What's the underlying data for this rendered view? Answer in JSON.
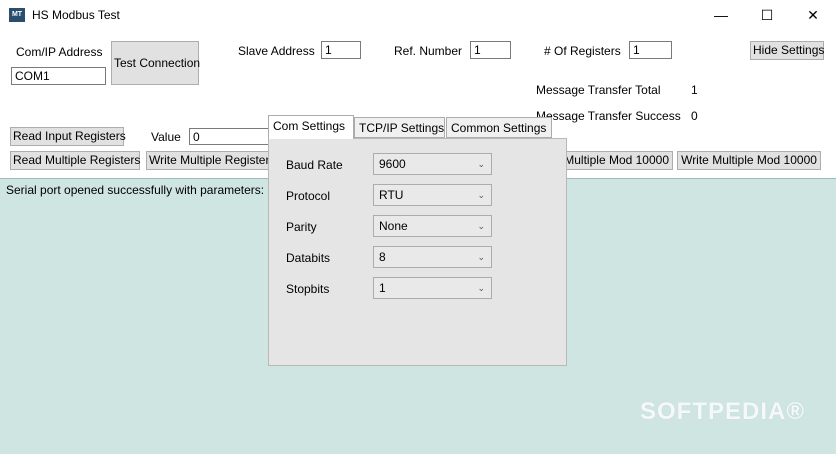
{
  "window": {
    "app_icon_text": "MT",
    "title": "HS Modbus Test",
    "minimize": "—",
    "maximize": "☐",
    "close": "✕"
  },
  "connection": {
    "com_ip_label": "Com/IP Address",
    "com_ip_value": "COM1",
    "test_button": "Test Connection",
    "slave_label": "Slave Address",
    "slave_value": "1",
    "ref_label": "Ref. Number",
    "ref_value": "1",
    "regs_label": "# Of Registers",
    "regs_value": "1",
    "hide_settings": "Hide Settings"
  },
  "stats": {
    "total_label": "Message Transfer Total",
    "total_value": "1",
    "success_label": "Message Transfer Success",
    "success_value": "0"
  },
  "actions": {
    "read_input": "Read Input Registers",
    "value_label": "Value",
    "value_value": "0",
    "read_multiple": "Read Multiple Registers",
    "write_multiple": "Write Multiple Registers",
    "read_mod_partial": "Multiple Mod 10000",
    "write_mod": "Write Multiple Mod 10000"
  },
  "log": {
    "text": "Serial port opened successfully with parameters: C"
  },
  "settings": {
    "tabs": [
      "Com Settings",
      "TCP/IP Settings",
      "Common Settings"
    ],
    "rows": [
      {
        "label": "Baud Rate",
        "value": "9600"
      },
      {
        "label": "Protocol",
        "value": "RTU"
      },
      {
        "label": "Parity",
        "value": "None"
      },
      {
        "label": "Databits",
        "value": "8"
      },
      {
        "label": "Stopbits",
        "value": "1"
      }
    ],
    "chevron": "⌄"
  },
  "watermark": "SOFTPEDIA®"
}
